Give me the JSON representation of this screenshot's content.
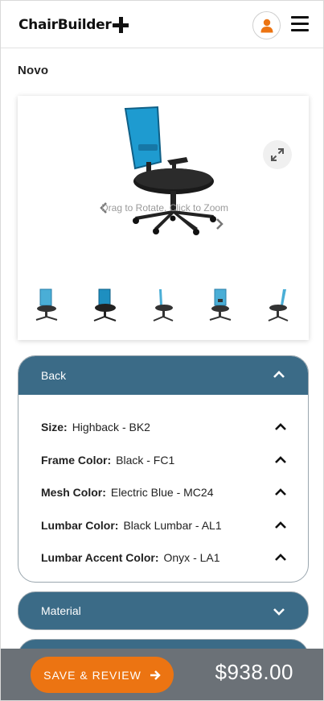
{
  "header": {
    "logo_text": "ChairBuilder",
    "account_icon": "user-icon",
    "menu_icon": "hamburger-icon"
  },
  "product": {
    "name": "Novo"
  },
  "viewer": {
    "hint": "Drag to Rotate. Click to Zoom",
    "zoom_icon": "expand-icon",
    "thumbnail_count": 5
  },
  "accordion": {
    "back": {
      "title": "Back",
      "expanded": true,
      "options": [
        {
          "label": "Size:",
          "value": "Highback - BK2"
        },
        {
          "label": "Frame Color:",
          "value": "Black - FC1"
        },
        {
          "label": "Mesh Color:",
          "value": "Electric Blue - MC24"
        },
        {
          "label": "Lumbar Color:",
          "value": "Black Lumbar - AL1"
        },
        {
          "label": "Lumbar Accent Color:",
          "value": "Onyx - LA1"
        }
      ]
    },
    "material": {
      "title": "Material",
      "expanded": false
    }
  },
  "footer": {
    "save_label": "SAVE & REVIEW",
    "price": "$938.00"
  },
  "colors": {
    "accent": "#ec7412",
    "panel": "#3b6b87",
    "footer": "#6b7177",
    "mesh": "#1e9bd0"
  }
}
